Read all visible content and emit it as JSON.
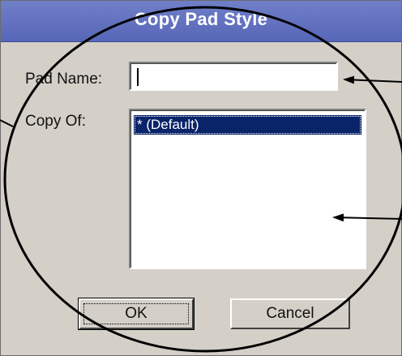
{
  "window": {
    "title": "Copy Pad Style"
  },
  "form": {
    "pad_name_label": "Pad Name:",
    "pad_name_value": "",
    "copy_of_label": "Copy Of:",
    "copy_of_items": [
      {
        "label": "* (Default)",
        "selected": true
      }
    ]
  },
  "buttons": {
    "ok_label": "OK",
    "cancel_label": "Cancel"
  },
  "colors": {
    "titlebar": "#5f6fc0",
    "dialog_bg": "#d4d0c8",
    "selection": "#0a246a",
    "annotation": "#000000"
  },
  "annotations": {
    "description_shapes": [
      "ellipse",
      "arrow-to-pad-name-field",
      "arrow-to-copy-of-list",
      "pointer-line-left"
    ]
  }
}
